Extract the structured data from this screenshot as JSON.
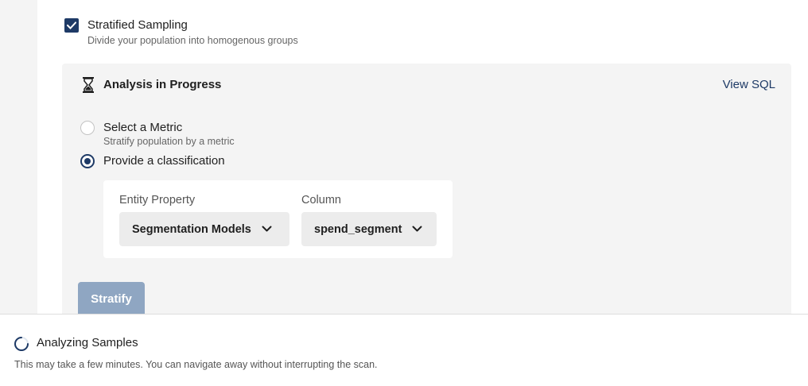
{
  "stratified": {
    "checked": true,
    "title": "Stratified Sampling",
    "description": "Divide your population into homogenous groups"
  },
  "panel": {
    "status_icon": "hourglass-icon",
    "title": "Analysis in Progress",
    "view_sql_label": "View SQL"
  },
  "options": {
    "metric": {
      "label": "Select a Metric",
      "description": "Stratify population by a metric",
      "selected": false
    },
    "classification": {
      "label": "Provide a classification",
      "selected": true
    }
  },
  "classification": {
    "entity_property": {
      "label": "Entity Property",
      "value": "Segmentation Models"
    },
    "column": {
      "label": "Column",
      "value": "spend_segment"
    }
  },
  "actions": {
    "stratify_label": "Stratify"
  },
  "notification": {
    "icon": "spinner-icon",
    "title": "Analyzing Samples",
    "message": "This may take a few minutes. You can navigate away without interrupting the scan."
  },
  "colors": {
    "accent": "#1e3a66",
    "button_disabled": "#8fa6c2",
    "panel_bg": "#f4f4f4"
  }
}
